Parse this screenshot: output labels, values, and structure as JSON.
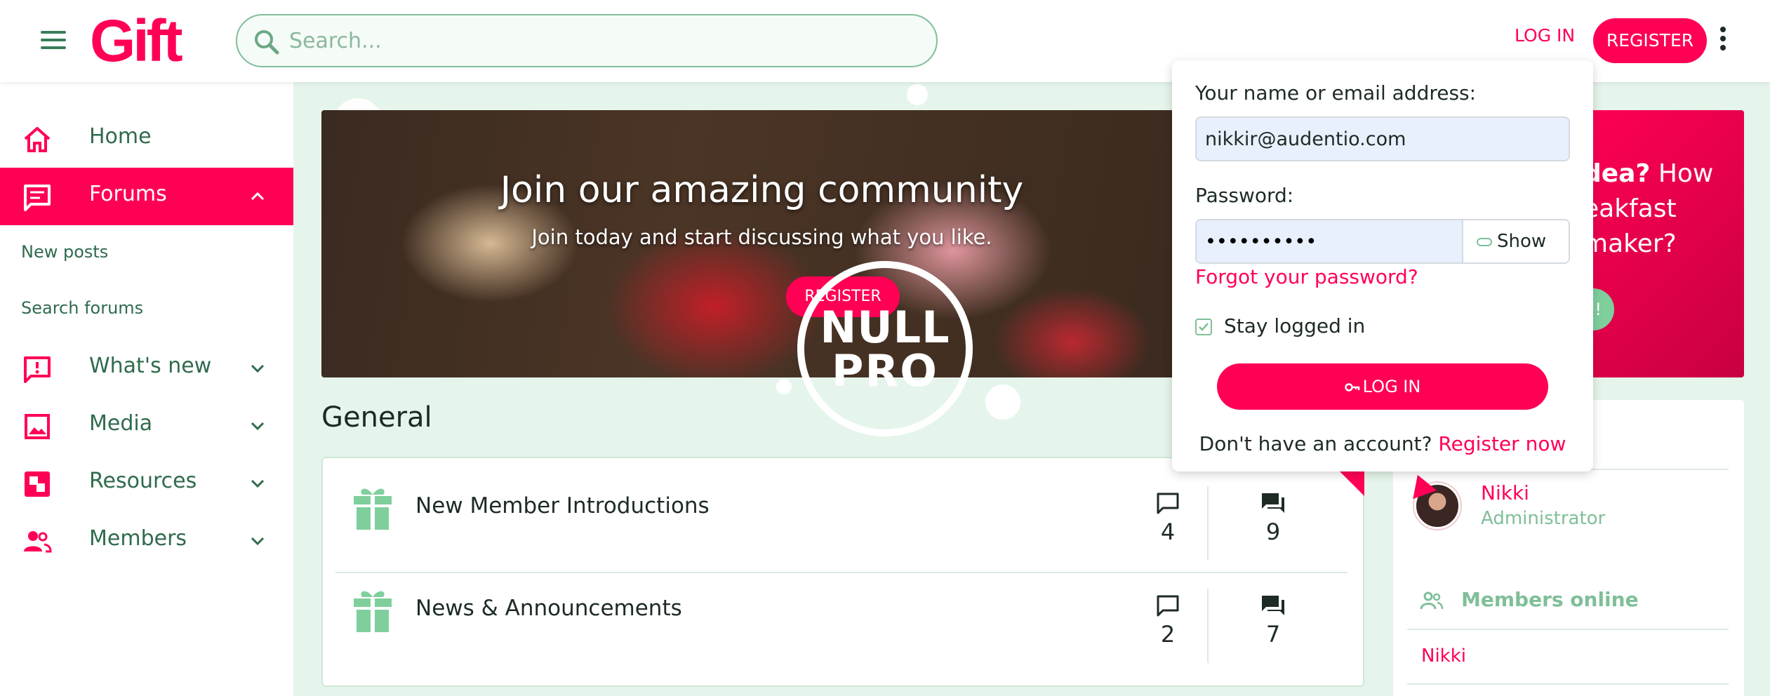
{
  "header": {
    "logo": "Gift",
    "search_placeholder": "Search...",
    "login_label": "LOG IN",
    "register_label": "REGISTER"
  },
  "sidebar": {
    "items": [
      {
        "label": "Home",
        "icon": "home-icon"
      },
      {
        "label": "Forums",
        "icon": "forum-icon",
        "active": true
      },
      {
        "label": "What's new",
        "icon": "whats-new-icon"
      },
      {
        "label": "Media",
        "icon": "image-icon"
      },
      {
        "label": "Resources",
        "icon": "resources-icon"
      },
      {
        "label": "Members",
        "icon": "members-icon"
      }
    ],
    "sub_items": [
      "New posts",
      "Search forums"
    ]
  },
  "banner": {
    "title": "Join our amazing community",
    "subtitle": "Join today and start discussing what you like.",
    "button": "REGISTER"
  },
  "side_banner": {
    "line1_bold": "dea?",
    "line1_rest": " How",
    "line2": "eakfast",
    "line3": "maker?",
    "button": "!"
  },
  "watermark": {
    "line1": "NULL",
    "line2": "PRO"
  },
  "general": {
    "title": "General",
    "forums": [
      {
        "name": "New Member Introductions",
        "threads": "4",
        "messages": "9"
      },
      {
        "name": "News & Announcements",
        "threads": "2",
        "messages": "7"
      }
    ]
  },
  "right_panel": {
    "user_name": "Nikki",
    "user_role": "Administrator",
    "members_online_title": "Members online",
    "online_members": [
      "Nikki"
    ]
  },
  "login_popup": {
    "name_label": "Your name or email address:",
    "name_value": "nikkir@audentio.com",
    "password_label": "Password:",
    "password_value": "••••••••••",
    "show_label": "Show",
    "forgot_label": "Forgot your password?",
    "stay_logged_in": "Stay logged in",
    "login_button": "LOG IN",
    "no_account_text": "Don't have an account?",
    "register_now": "Register now"
  },
  "colors": {
    "accent": "#ff0055",
    "green": "#2f6b4c",
    "light_green": "#7fbf98",
    "bg": "#e6f5ec"
  }
}
